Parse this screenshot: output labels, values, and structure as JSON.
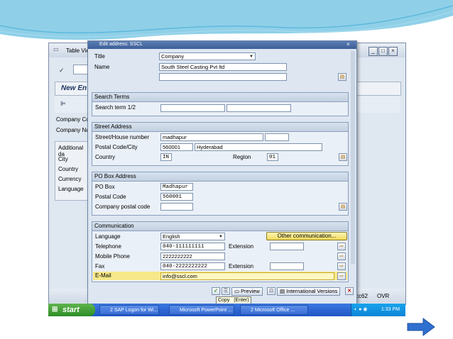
{
  "background_window": {
    "title": "Table Vie",
    "banner": "New En",
    "labels": [
      "Company Co",
      "Company Nar",
      "Additional da",
      "City",
      "Country",
      "Currency",
      "Language"
    ],
    "status_code": "cc62",
    "status_mode": "OVR"
  },
  "dialog": {
    "title": "Edit address: SSCL",
    "title_label": "Title",
    "title_value": "Company",
    "name_label": "Name",
    "name_value": "South Steel Casting Pvt ltd",
    "search_terms": {
      "header": "Search Terms",
      "term_label": "Search term 1/2"
    },
    "street_address": {
      "header": "Street Address",
      "street_label": "Street/House number",
      "street_value": "madhapur",
      "postal_label": "Postal Code/City",
      "postal_value": "560001",
      "city_value": "Hyderabad",
      "country_label": "Country",
      "country_value": "IN",
      "region_label": "Region",
      "region_value": "01"
    },
    "po_box": {
      "header": "PO Box Address",
      "pobox_label": "PO Box",
      "pobox_value": "Madhapur",
      "postal_label": "Postal Code",
      "postal_value": "560001",
      "company_postal_label": "Company postal code"
    },
    "communication": {
      "header": "Communication",
      "language_label": "Language",
      "language_value": "English",
      "other_btn": "Other communication...",
      "telephone_label": "Telephone",
      "telephone_value": "040-111111111",
      "extension_label": "Extension",
      "mobile_label": "Mobile Phone",
      "mobile_value": "2222222222",
      "fax_label": "Fax",
      "fax_value": "040-2222222222",
      "fax_extension_label": "Extension",
      "email_label": "E-Mail",
      "email_value": "info@sscl.com"
    },
    "toolbar": {
      "preview": "Preview",
      "intl": "International Versions",
      "tooltip_copy": "Copy",
      "tooltip_key": "(Enter)"
    }
  },
  "taskbar": {
    "start": "start",
    "tasks": [
      "2 SAP Logon for Wi...",
      "Microsoft PowerPoint ...",
      "2 Microsoft Office ..."
    ],
    "clock": "1:33 PM"
  },
  "colors": {
    "accent_blue": "#3d5f97",
    "highlight_yellow": "#f7e98a",
    "taskbar_blue": "#2a63d0",
    "start_green": "#3a9a30",
    "arrow_blue": "#2f6fd0"
  }
}
